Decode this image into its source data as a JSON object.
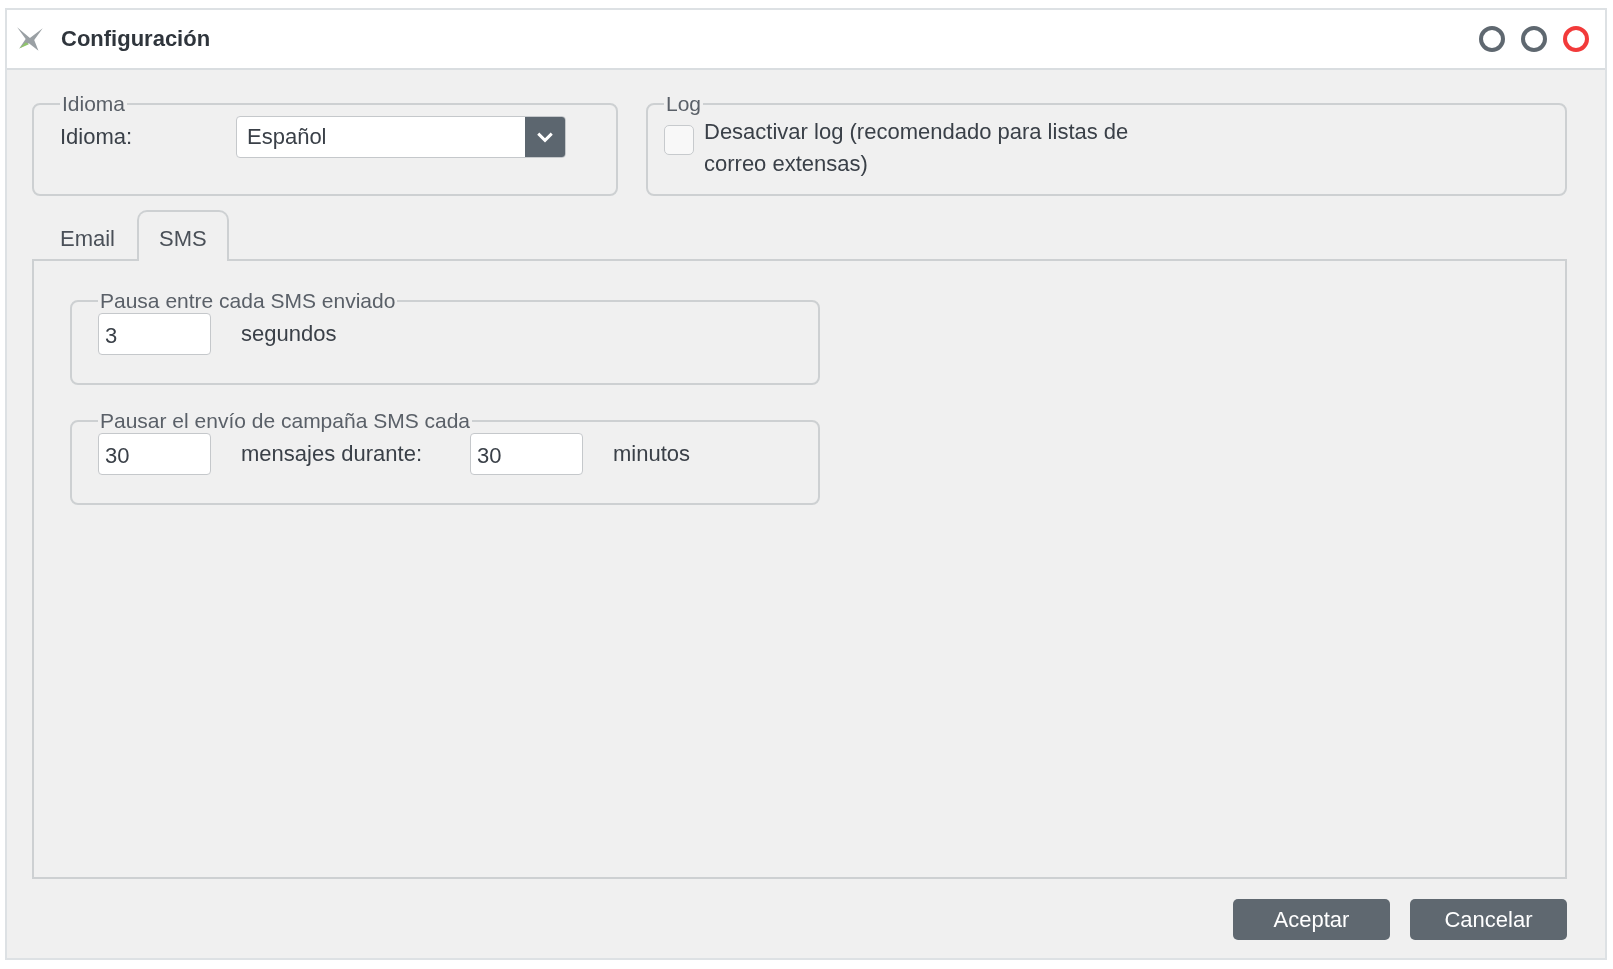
{
  "window": {
    "title": "Configuración"
  },
  "language_group": {
    "legend": "Idioma",
    "label": "Idioma:",
    "value": "Español"
  },
  "log_group": {
    "legend": "Log",
    "checked": false,
    "label": "Desactivar log (recomendado para listas de correo extensas)"
  },
  "tabs": [
    {
      "label": "Email",
      "selected": false
    },
    {
      "label": "SMS",
      "selected": true
    }
  ],
  "sms_pause": {
    "legend": "Pausa entre cada SMS enviado",
    "value": "3",
    "unit": "segundos"
  },
  "campaign_pause": {
    "legend": "Pausar el envío de campaña SMS cada",
    "messages_value": "30",
    "messages_label": "mensajes durante:",
    "minutes_value": "30",
    "minutes_unit": "minutos"
  },
  "buttons": [
    "Aceptar",
    "Cancelar"
  ]
}
